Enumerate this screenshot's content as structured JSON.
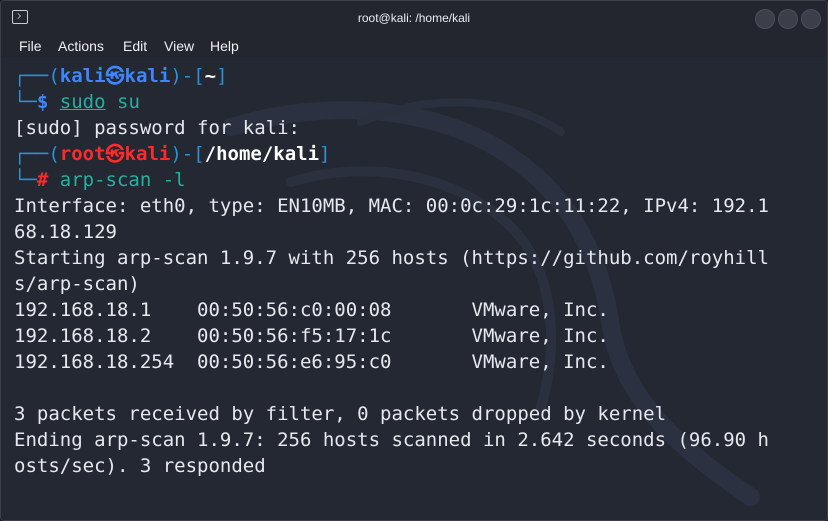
{
  "window": {
    "title": "root@kali: /home/kali"
  },
  "menu": [
    "File",
    "Actions",
    "Edit",
    "View",
    "Help"
  ],
  "prompt1": {
    "open": "┌──(",
    "user": "kali",
    "skull": "㉿",
    "host": "kali",
    "close": ")-[",
    "path": "~",
    "end": "]",
    "corner": "└─",
    "symbol": "$",
    "command1": "sudo",
    "command2": " su"
  },
  "sudo_line": "[sudo] password for kali:",
  "prompt2": {
    "open": "┌──(",
    "user": "root",
    "skull": "㉿",
    "host": "kali",
    "close": ")-[",
    "path": "/home/kali",
    "end": "]",
    "corner": "└─",
    "symbol": "#",
    "command": " arp-scan -l"
  },
  "output": [
    "Interface: eth0, type: EN10MB, MAC: 00:0c:29:1c:11:22, IPv4: 192.1",
    "68.18.129",
    "Starting arp-scan 1.9.7 with 256 hosts (https://github.com/royhill",
    "s/arp-scan)",
    "192.168.18.1    00:50:56:c0:00:08       VMware, Inc.",
    "192.168.18.2    00:50:56:f5:17:1c       VMware, Inc.",
    "192.168.18.254  00:50:56:e6:95:c0       VMware, Inc.",
    "",
    "3 packets received by filter, 0 packets dropped by kernel",
    "Ending arp-scan 1.9.7: 256 hosts scanned in 2.642 seconds (96.90 h",
    "osts/sec). 3 responded"
  ]
}
